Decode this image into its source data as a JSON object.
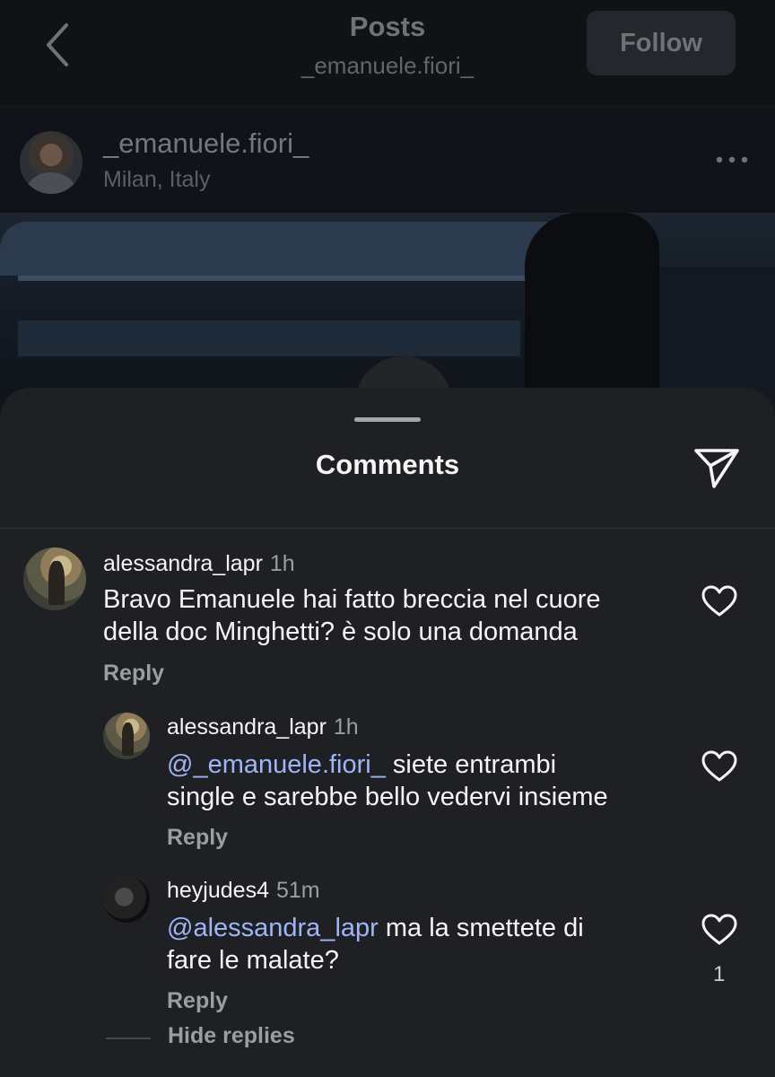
{
  "header": {
    "title": "Posts",
    "subtitle": "_emanuele.fiori_",
    "follow_label": "Follow"
  },
  "post": {
    "author": "_emanuele.fiori_",
    "location": "Milan, Italy"
  },
  "comments_sheet": {
    "title": "Comments",
    "comments": [
      {
        "username": "alessandra_lapr",
        "time": "1h",
        "text_line1": "Bravo Emanuele hai fatto breccia nel cuore",
        "text_line2": "della doc Minghetti? è solo una domanda",
        "reply_label": "Reply"
      },
      {
        "username": "alessandra_lapr",
        "time": "1h",
        "mention": "@_emanuele.fiori_",
        "text_line1_rest": " siete entrambi",
        "text_line2": "single e sarebbe bello vedervi insieme",
        "reply_label": "Reply"
      },
      {
        "username": "heyjudes4",
        "time": "51m",
        "mention": "@alessandra_lapr",
        "text_line1_rest": " ma la smettete di",
        "text_line2": "fare le malate?",
        "reply_label": "Reply",
        "like_count": "1"
      }
    ],
    "hide_replies_label": "Hide replies"
  },
  "icons": {
    "back": "chevron-left-icon",
    "more": "more-horizontal-icon",
    "share": "send-icon",
    "like": "heart-outline-icon"
  },
  "colors": {
    "sheet_bg": "#1f2023",
    "mention": "#9fb5f6",
    "secondary_text": "#9a9da1"
  }
}
